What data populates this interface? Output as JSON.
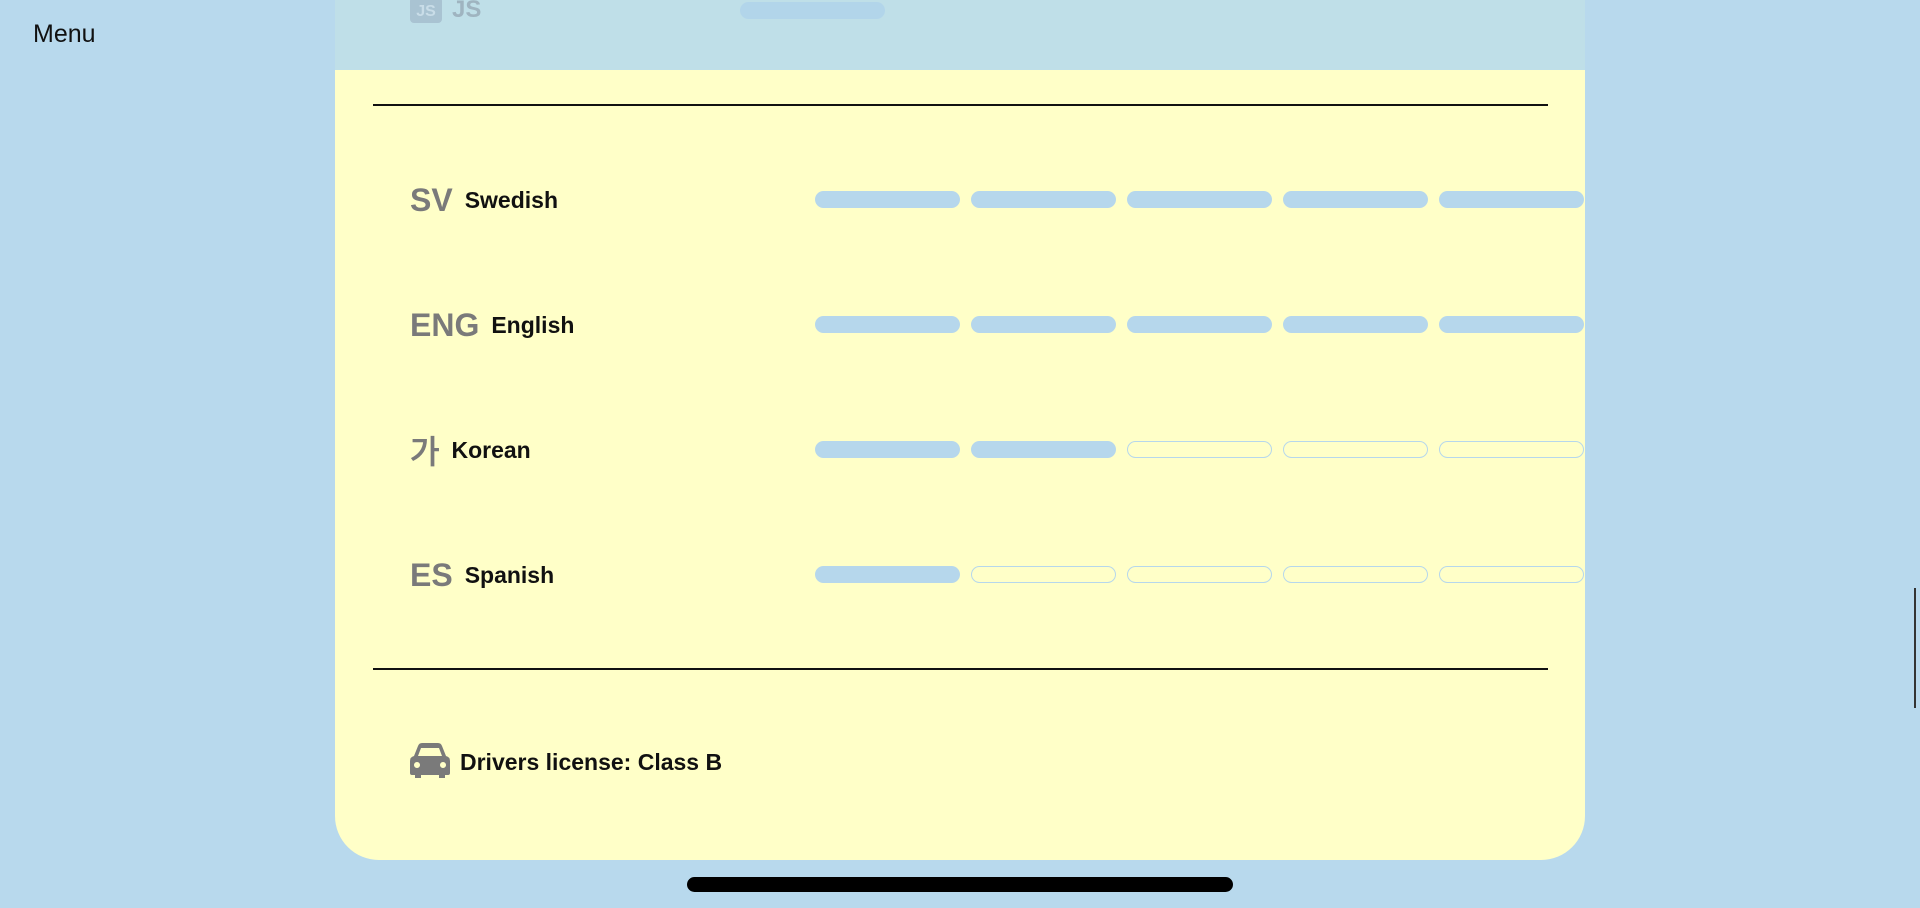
{
  "menu_label": "Menu",
  "skills_partial": {
    "code": "JS",
    "icon": "js-logo-icon"
  },
  "languages": [
    {
      "code": "SV",
      "name": "Swedish",
      "level": 5,
      "max": 5
    },
    {
      "code": "ENG",
      "name": "English",
      "level": 5,
      "max": 5
    },
    {
      "code": "가",
      "name": "Korean",
      "level": 2,
      "max": 5
    },
    {
      "code": "ES",
      "name": "Spanish",
      "level": 1,
      "max": 5
    }
  ],
  "license": {
    "icon": "car-icon",
    "text": "Drivers license: Class B"
  },
  "colors": {
    "background": "#b8d9ed",
    "card": "#ffffc8",
    "bar_fill": "#b6d7ec",
    "code_gray": "#7a7a7a"
  }
}
